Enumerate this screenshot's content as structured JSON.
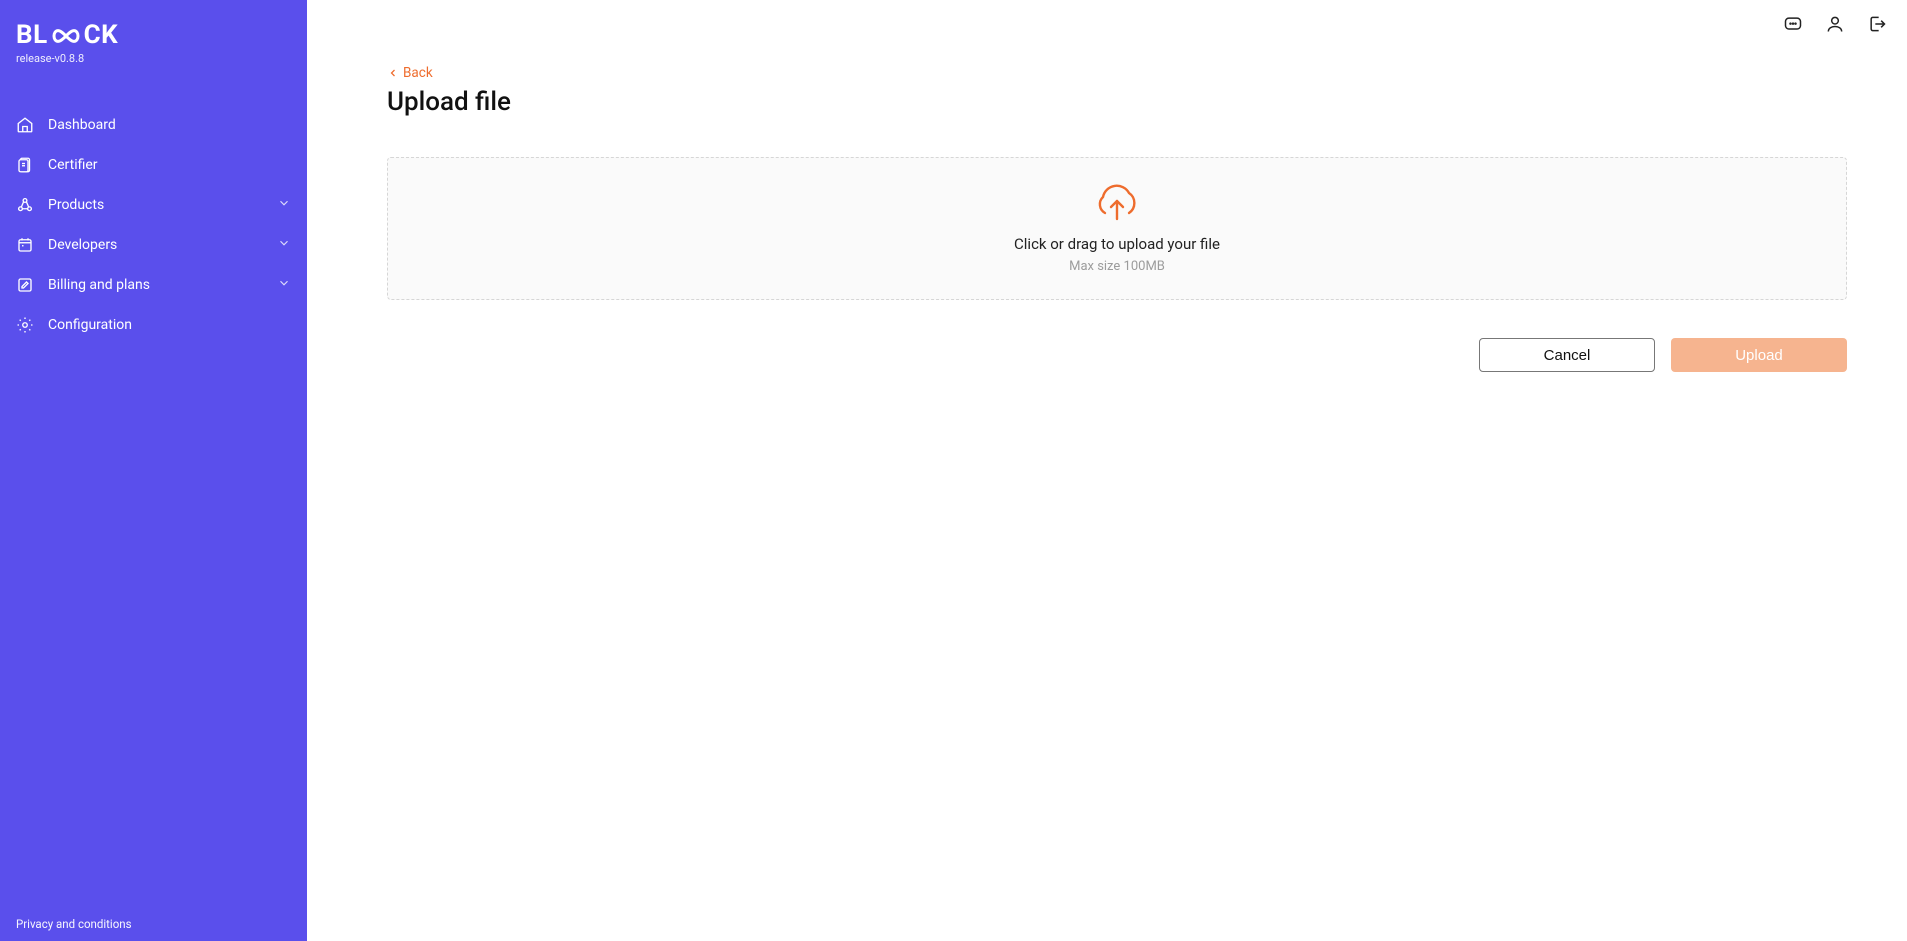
{
  "sidebar": {
    "logo_text_left": "BL",
    "logo_text_right": "CK",
    "release": "release-v0.8.8",
    "items": [
      {
        "label": "Dashboard",
        "expandable": false
      },
      {
        "label": "Certifier",
        "expandable": false
      },
      {
        "label": "Products",
        "expandable": true
      },
      {
        "label": "Developers",
        "expandable": true
      },
      {
        "label": "Billing and plans",
        "expandable": true
      },
      {
        "label": "Configuration",
        "expandable": false
      }
    ],
    "footer_link": "Privacy and conditions"
  },
  "main": {
    "back_label": "Back",
    "title": "Upload file",
    "upload_text": "Click or drag to upload your file",
    "upload_sub": "Max size 100MB",
    "cancel_label": "Cancel",
    "upload_label": "Upload"
  },
  "colors": {
    "sidebar_bg": "#5a4fec",
    "accent": "#ee6c2d",
    "upload_btn": "#f6b48f"
  }
}
